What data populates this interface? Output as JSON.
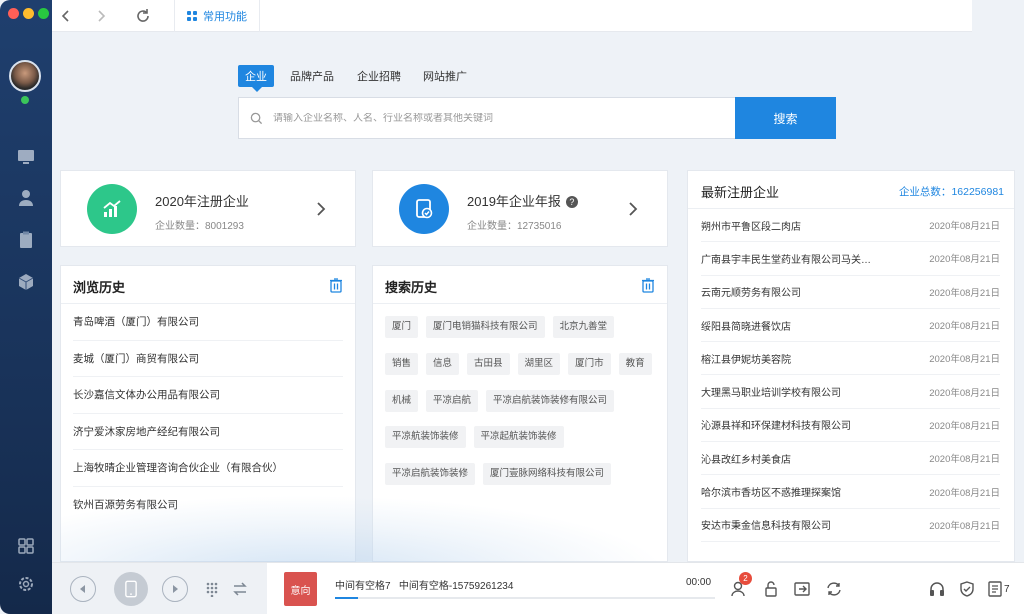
{
  "window": {
    "traffic_colors": [
      "#ff5f57",
      "#febc2e",
      "#28c840"
    ]
  },
  "topbar": {
    "tab_label": "常用功能"
  },
  "search": {
    "tabs": [
      "企业",
      "品牌产品",
      "企业招聘",
      "网站推广"
    ],
    "active_tab": "企业",
    "placeholder": "请输入企业名称、人名、行业名称或者其他关键词",
    "button_label": "搜索"
  },
  "stats": [
    {
      "title": "2020年注册企业",
      "count_label": "企业数量：",
      "count": "8001293",
      "icon": "trend-chart-icon",
      "color": "#2dc78a"
    },
    {
      "title": "2019年企业年报",
      "count_label": "企业数量：",
      "count": "12735016",
      "icon": "report-check-icon",
      "color": "#1f86e0"
    }
  ],
  "browse_history": {
    "title": "浏览历史",
    "items": [
      "青岛啤酒（厦门）有限公司",
      "麦城（厦门）商贸有限公司",
      "长沙嘉信文体办公用品有限公司",
      "济宁爱沐家房地产经纪有限公司",
      "上海牧晴企业管理咨询合伙企业（有限合伙）",
      "钦州百源劳务有限公司"
    ]
  },
  "search_history": {
    "title": "搜索历史",
    "tags": [
      "厦门",
      "厦门电销猫科技有限公司",
      "北京九善堂",
      "销售",
      "信息",
      "古田县",
      "湖里区",
      "厦门市",
      "教育",
      "机械",
      "平凉启航",
      "平凉启航装饰装修有限公司",
      "平凉航装饰装修",
      "平凉起航装饰装修",
      "平凉启航装饰装修",
      "厦门壹脉网络科技有限公司"
    ]
  },
  "new_companies": {
    "title": "最新注册企业",
    "total_label": "企业总数：",
    "total": "162256981",
    "items": [
      {
        "name": "朔州市平鲁区段二肉店",
        "date": "2020年08月21日"
      },
      {
        "name": "广南县宇丰民生堂药业有限公司马关…",
        "date": "2020年08月21日"
      },
      {
        "name": "云南元顺劳务有限公司",
        "date": "2020年08月21日"
      },
      {
        "name": "绥阳县简晓进餐饮店",
        "date": "2020年08月21日"
      },
      {
        "name": "榕江县伊妮坊美容院",
        "date": "2020年08月21日"
      },
      {
        "name": "大理黑马职业培训学校有限公司",
        "date": "2020年08月21日"
      },
      {
        "name": "沁源县祥和环保建材科技有限公司",
        "date": "2020年08月21日"
      },
      {
        "name": "沁县改红乡村美食店",
        "date": "2020年08月21日"
      },
      {
        "name": "哈尔滨市香坊区不惑推理探案馆",
        "date": "2020年08月21日"
      },
      {
        "name": "安达市秉金信息科技有限公司",
        "date": "2020年08月21日"
      }
    ]
  },
  "call_bar": {
    "avatar_label": "意向",
    "line1": "中间有空格7",
    "line2": "中间有空格-15759261234",
    "time": "00:00",
    "progress": 0.06,
    "badge_count": "2",
    "tiny_count": "7"
  }
}
